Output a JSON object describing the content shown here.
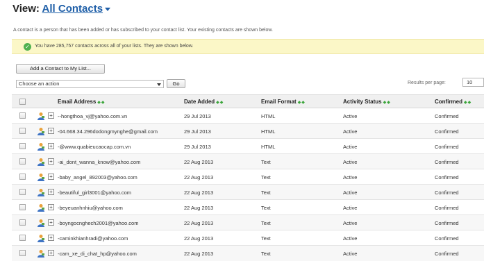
{
  "view": {
    "label": "View:",
    "selected": "All Contacts"
  },
  "intro_text": "A contact is a person that has been added or has subscribed to your contact list. Your existing contacts are shown below.",
  "notice": {
    "icon": "check-circle-icon",
    "message": "You have 285,757 contacts across all of your lists. They are shown below."
  },
  "toolbar": {
    "add_button": "Add a Contact to My List...",
    "action_select": "Choose an action",
    "go_button": "Go",
    "results_per_page_label": "Results per page:",
    "results_per_page_value": "10"
  },
  "table": {
    "headers": {
      "email": "Email Address",
      "date": "Date Added",
      "format": "Email Format",
      "status": "Activity Status",
      "confirmed": "Confirmed"
    },
    "rows": [
      {
        "email": "--hongthoa_vj@yahoo.com.vn",
        "date": "29 Jul 2013",
        "format": "HTML",
        "status": "Active",
        "confirmed": "Confirmed"
      },
      {
        "email": "-04.668.34.296dodongmynghe@gmail.com",
        "date": "29 Jul 2013",
        "format": "HTML",
        "status": "Active",
        "confirmed": "Confirmed"
      },
      {
        "email": "-@www.quabieucaocap.com.vn",
        "date": "29 Jul 2013",
        "format": "HTML",
        "status": "Active",
        "confirmed": "Confirmed"
      },
      {
        "email": "-ai_dont_wanna_know@yahoo.com",
        "date": "22 Aug 2013",
        "format": "Text",
        "status": "Active",
        "confirmed": "Confirmed"
      },
      {
        "email": "-baby_angel_892003@yahoo.com",
        "date": "22 Aug 2013",
        "format": "Text",
        "status": "Active",
        "confirmed": "Confirmed"
      },
      {
        "email": "-beautiful_girl3001@yahoo.com",
        "date": "22 Aug 2013",
        "format": "Text",
        "status": "Active",
        "confirmed": "Confirmed"
      },
      {
        "email": "-beyeuanhnhiu@yahoo.com",
        "date": "22 Aug 2013",
        "format": "Text",
        "status": "Active",
        "confirmed": "Confirmed"
      },
      {
        "email": "-boyngocnghech2001@yahoo.com",
        "date": "22 Aug 2013",
        "format": "Text",
        "status": "Active",
        "confirmed": "Confirmed"
      },
      {
        "email": "-caminkhianhradi@yahoo.com",
        "date": "22 Aug 2013",
        "format": "Text",
        "status": "Active",
        "confirmed": "Confirmed"
      },
      {
        "email": "-cam_xe_di_chat_hp@yahoo.com",
        "date": "22 Aug 2013",
        "format": "Text",
        "status": "Active",
        "confirmed": "Confirmed"
      }
    ]
  },
  "colors": {
    "link": "#1f5fa8",
    "notice_bg": "#fbf7c7",
    "success": "#4fb14f",
    "sort_arrows": "#3aa53a"
  }
}
